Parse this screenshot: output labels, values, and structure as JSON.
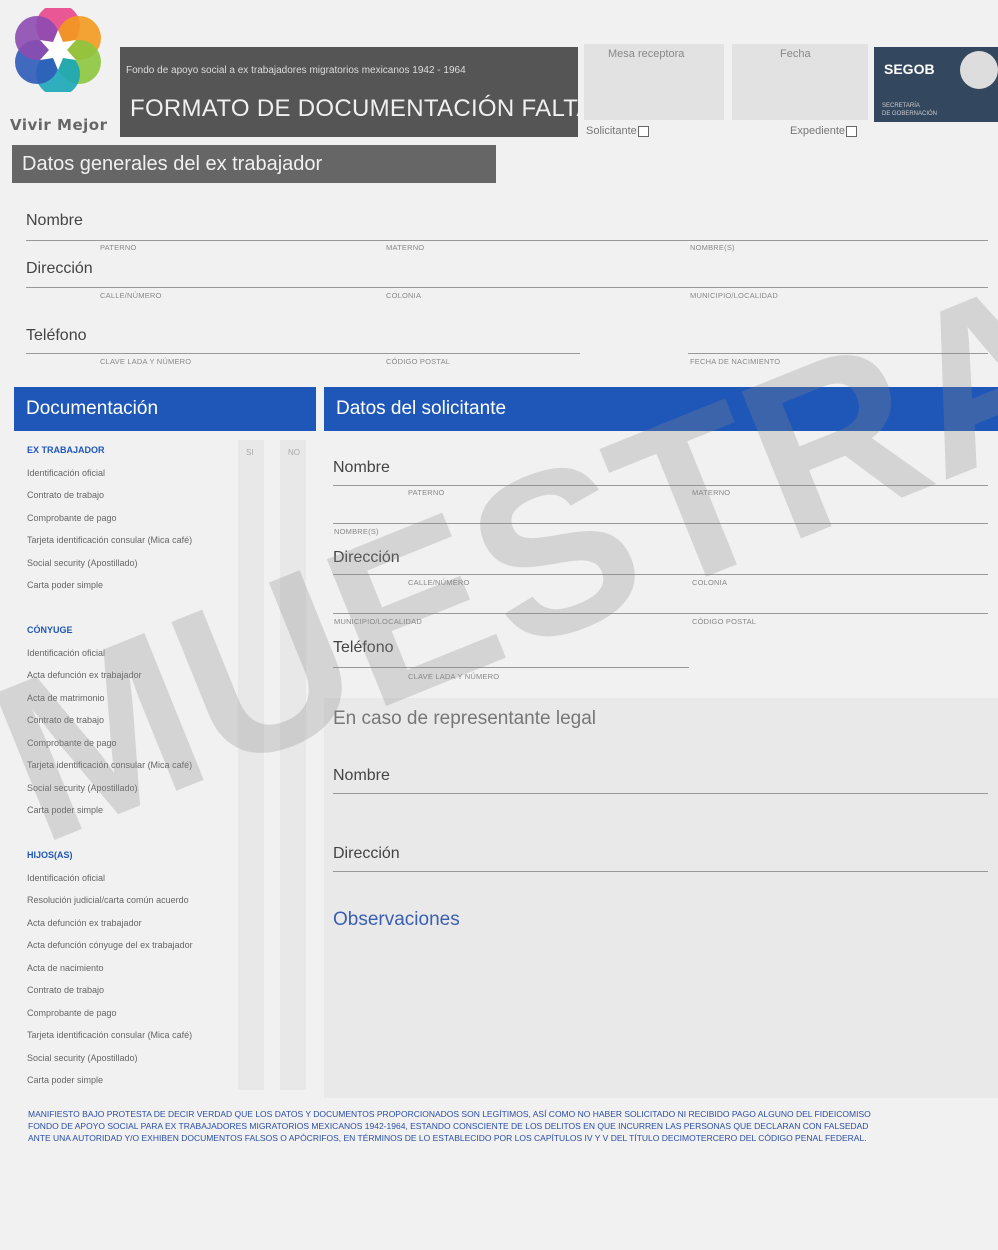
{
  "header": {
    "logo_text": "Vivir Mejor",
    "subtitle": "Fondo de apoyo social a ex trabajadores migratorios mexicanos 1942 - 1964",
    "title": "FORMATO DE DOCUMENTACIÓN FALTANTE",
    "mesa_label": "Mesa receptora",
    "fecha_label": "Fecha",
    "solicitante_check": "Solicitante",
    "expediente_check": "Expediente",
    "agency": "SEGOB",
    "agency_sub1": "SECRETARÍA",
    "agency_sub2": "DE GOBERNACIÓN"
  },
  "worker_section": {
    "title": "Datos generales del ex trabajador",
    "nombre": "Nombre",
    "direccion": "Dirección",
    "telefono": "Teléfono",
    "caps": {
      "paterno": "PATERNO",
      "materno": "MATERNO",
      "nombres": "NOMBRE(S)",
      "calle": "CALLE/NÚMERO",
      "colonia": "COLONIA",
      "municipio": "MUNICIPIO/LOCALIDAD",
      "clave_lada": "CLAVE LADA Y NÚMERO",
      "codigo_postal": "CÓDIGO POSTAL",
      "fecha_nac": "FECHA DE NACIMIENTO"
    }
  },
  "documentacion": {
    "title": "Documentación",
    "si": "SI",
    "no": "NO",
    "groups": [
      {
        "name": "EX TRABAJADOR",
        "items": [
          "Identificación oficial",
          "Contrato de trabajo",
          "Comprobante de pago",
          "Tarjeta identificación consular (Mica café)",
          "Social security (Apostillado)",
          "Carta poder simple"
        ]
      },
      {
        "name": "CÓNYUGE",
        "items": [
          "Identificación oficial",
          "Acta defunción ex trabajador",
          "Acta de matrimonio",
          "Contrato de trabajo",
          "Comprobante de pago",
          "Tarjeta identificación consular (Mica café)",
          "Social security (Apostillado)",
          "Carta poder simple"
        ]
      },
      {
        "name": "HIJOS(AS)",
        "items": [
          "Identificación oficial",
          "Resolución judicial/carta común acuerdo",
          "Acta defunción ex trabajador",
          "Acta defunción cónyuge del ex trabajador",
          "Acta de nacimiento",
          "Contrato de trabajo",
          "Comprobante de pago",
          "Tarjeta identificación consular (Mica café)",
          "Social security (Apostillado)",
          "Carta poder simple"
        ]
      }
    ]
  },
  "solicitante": {
    "title": "Datos del solicitante",
    "nombre": "Nombre",
    "direccion": "Dirección",
    "telefono": "Teléfono",
    "caps": {
      "paterno": "PATERNO",
      "materno": "MATERNO",
      "nombres": "NOMBRE(S)",
      "calle": "CALLE/NÚMERO",
      "colonia": "COLONIA",
      "municipio": "MUNICIPIO/LOCALIDAD",
      "codigo_postal": "CÓDIGO POSTAL",
      "clave_lada": "CLAVE LADA Y NÚMERO"
    },
    "representante_title": "En caso de representante legal",
    "rep_nombre": "Nombre",
    "rep_direccion": "Dirección",
    "observaciones": "Observaciones"
  },
  "footer": {
    "line1": "MANIFIESTO BAJO PROTESTA DE DECIR VERDAD QUE LOS DATOS Y DOCUMENTOS PROPORCIONADOS SON LEGÍTIMOS, ASÍ COMO NO HABER SOLICITADO NI RECIBIDO PAGO ALGUNO DEL FIDEICOMISO",
    "line2": "FONDO DE APOYO SOCIAL PARA EX TRABAJADORES MIGRATORIOS MEXICANOS 1942-1964, ESTANDO CONSCIENTE DE LOS DELITOS EN QUE INCURREN LAS PERSONAS QUE DECLARAN CON FALSEDAD",
    "line3": "ANTE UNA AUTORIDAD Y/O EXHIBEN DOCUMENTOS FALSOS O APÓCRIFOS, EN TÉRMINOS DE LO ESTABLECIDO POR LOS CAPÍTULOS IV Y V DEL TÍTULO DECIMOTERCERO DEL CÓDIGO PENAL FEDERAL."
  },
  "watermark": "MUESTRA",
  "colors": {
    "blue": "#1f57b8",
    "gray_bar": "#666666",
    "segob": "#33475f"
  }
}
